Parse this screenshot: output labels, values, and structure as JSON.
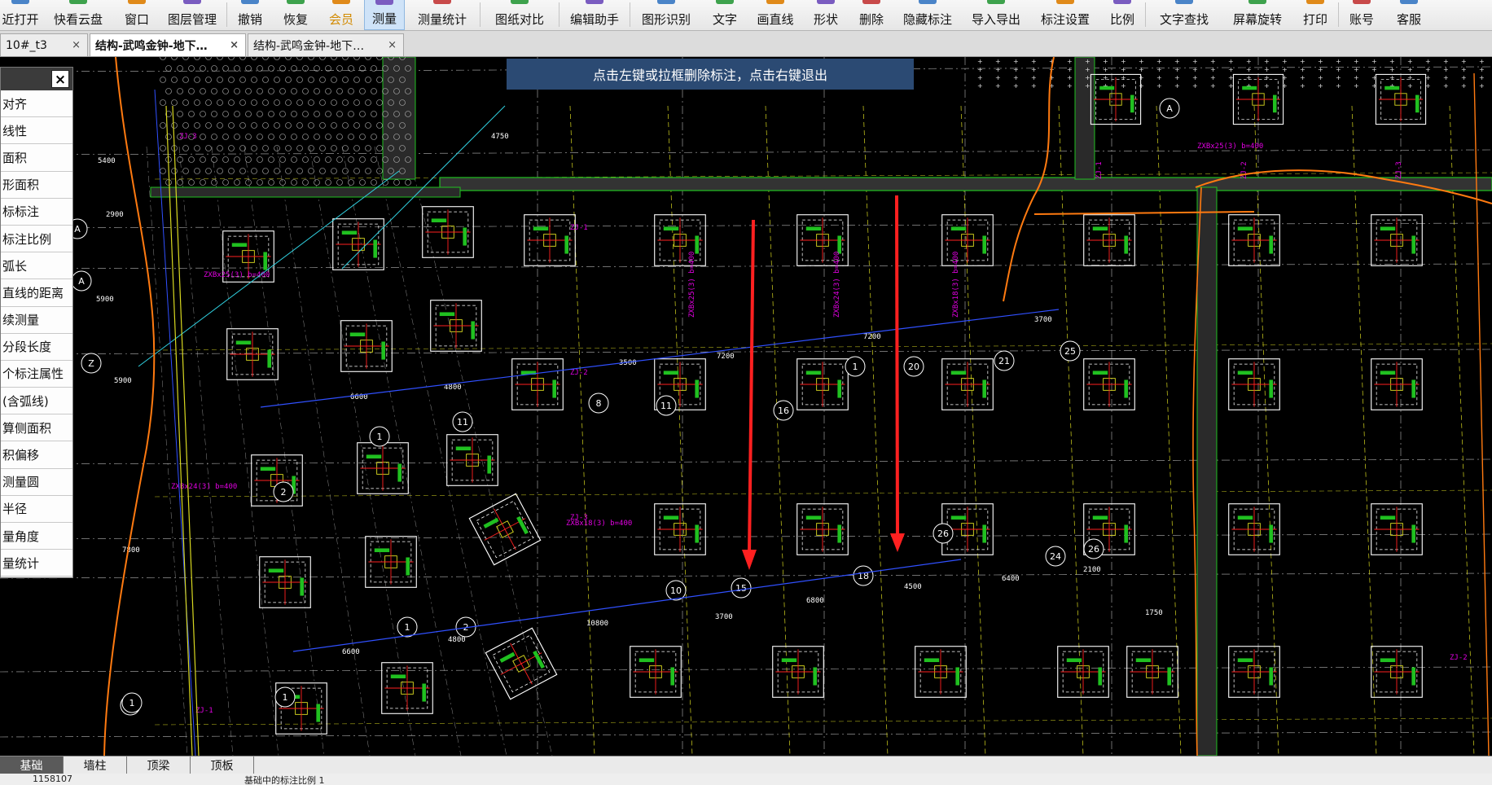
{
  "toolbar": {
    "items": [
      {
        "label": "近打开",
        "icon": "folder-open-icon",
        "width": 50
      },
      {
        "label": "快看云盘",
        "icon": "cloud-icon",
        "width": 92
      },
      {
        "label": "窗口",
        "icon": "window-icon",
        "width": 52
      },
      {
        "label": "图层管理",
        "icon": "layers-icon",
        "width": 84
      },
      {
        "sep": true
      },
      {
        "label": "撤销",
        "icon": "undo-icon",
        "width": 56
      },
      {
        "label": "恢复",
        "icon": "redo-icon",
        "width": 56
      },
      {
        "label": "会员",
        "icon": "vip-icon",
        "width": 56,
        "vip": true
      },
      {
        "label": "测量",
        "icon": "ruler-icon",
        "width": 50,
        "active": true
      },
      {
        "label": "测量统计",
        "icon": "measure-stats-icon",
        "width": 92
      },
      {
        "sep": true
      },
      {
        "label": "图纸对比",
        "icon": "compare-icon",
        "width": 96
      },
      {
        "sep": true
      },
      {
        "label": "编辑助手",
        "icon": "edit-assistant-icon",
        "width": 86
      },
      {
        "sep": true
      },
      {
        "label": "图形识别",
        "icon": "shape-recognition-icon",
        "width": 88
      },
      {
        "label": "文字",
        "icon": "text-icon",
        "width": 56
      },
      {
        "label": "画直线",
        "icon": "line-icon",
        "width": 68
      },
      {
        "label": "形状",
        "icon": "shape-icon",
        "width": 56
      },
      {
        "label": "删除",
        "icon": "eraser-icon",
        "width": 56
      },
      {
        "label": "隐藏标注",
        "icon": "hide-annotation-icon",
        "width": 82
      },
      {
        "label": "导入导出",
        "icon": "import-export-icon",
        "width": 86
      },
      {
        "label": "标注设置",
        "icon": "annotation-settings-icon",
        "width": 84
      },
      {
        "label": "比例",
        "icon": "scale-icon",
        "width": 56
      },
      {
        "sep": true
      },
      {
        "label": "文字查找",
        "icon": "text-search-icon",
        "width": 94
      },
      {
        "label": "屏幕旋转",
        "icon": "rotate-screen-icon",
        "width": 86
      },
      {
        "label": "打印",
        "icon": "print-icon",
        "width": 56
      },
      {
        "sep": true
      },
      {
        "label": "账号",
        "icon": "account-icon",
        "width": 56
      },
      {
        "label": "客服",
        "icon": "headset-icon",
        "width": 60
      }
    ]
  },
  "tabs": [
    {
      "label": "10#_t3",
      "active": false,
      "width": 108
    },
    {
      "label": "结构-武鸣金钟-地下…",
      "active": true,
      "width": 192
    },
    {
      "label": "结构-武鸣金钟-地下…",
      "active": false,
      "width": 192
    }
  ],
  "hint": "点击左键或拉框删除标注，点击右键退出",
  "measure_panel": {
    "items": [
      "对齐",
      "线性",
      "面积",
      "形面积",
      "标标注",
      "标注比例",
      "弧长",
      "直线的距离",
      "续测量",
      "分段长度",
      "个标注属性",
      "(含弧线)",
      "算侧面积",
      "积偏移",
      "测量圆",
      "半径",
      "量角度",
      "量统计"
    ]
  },
  "sheets": [
    {
      "label": "基础",
      "active": true
    },
    {
      "label": "墙柱",
      "active": false
    },
    {
      "label": "顶梁",
      "active": false
    },
    {
      "label": "顶板",
      "active": false
    }
  ],
  "status": {
    "coords": "1158107",
    "scale_text": "基础中的标注比例 1"
  },
  "drawing": {
    "axis_labels": [
      "A",
      "A",
      "A",
      "A",
      "Z",
      "1",
      "1",
      "2",
      "11",
      "10",
      "11",
      "15",
      "16",
      "18",
      "20",
      "21",
      "24",
      "25",
      "26",
      "26",
      "8",
      "1",
      "1",
      "2",
      "1"
    ],
    "dimensions": [
      "3500",
      "7200",
      "7200",
      "3700",
      "6600",
      "4800",
      "6800",
      "4500",
      "6400",
      "2100",
      "1750",
      "10800",
      "4800",
      "3700",
      "6600",
      "5900",
      "2900",
      "5400",
      "4750",
      "5900",
      "7800"
    ],
    "labels": [
      "ZJ-1",
      "ZJ-2",
      "ZJ-3",
      "ZXBx25(3) b=400",
      "ZXBx24(3) b=400",
      "ZXBx18(3) b=400"
    ],
    "colors": {
      "background": "#000000",
      "grid": "#ffffff",
      "red": "#ff2020",
      "green": "#20c020",
      "magenta": "#e000e0",
      "yellow": "#d8d820",
      "orange": "#ff7a10",
      "blue": "#3050ff",
      "cyan": "#30d0e0"
    }
  }
}
